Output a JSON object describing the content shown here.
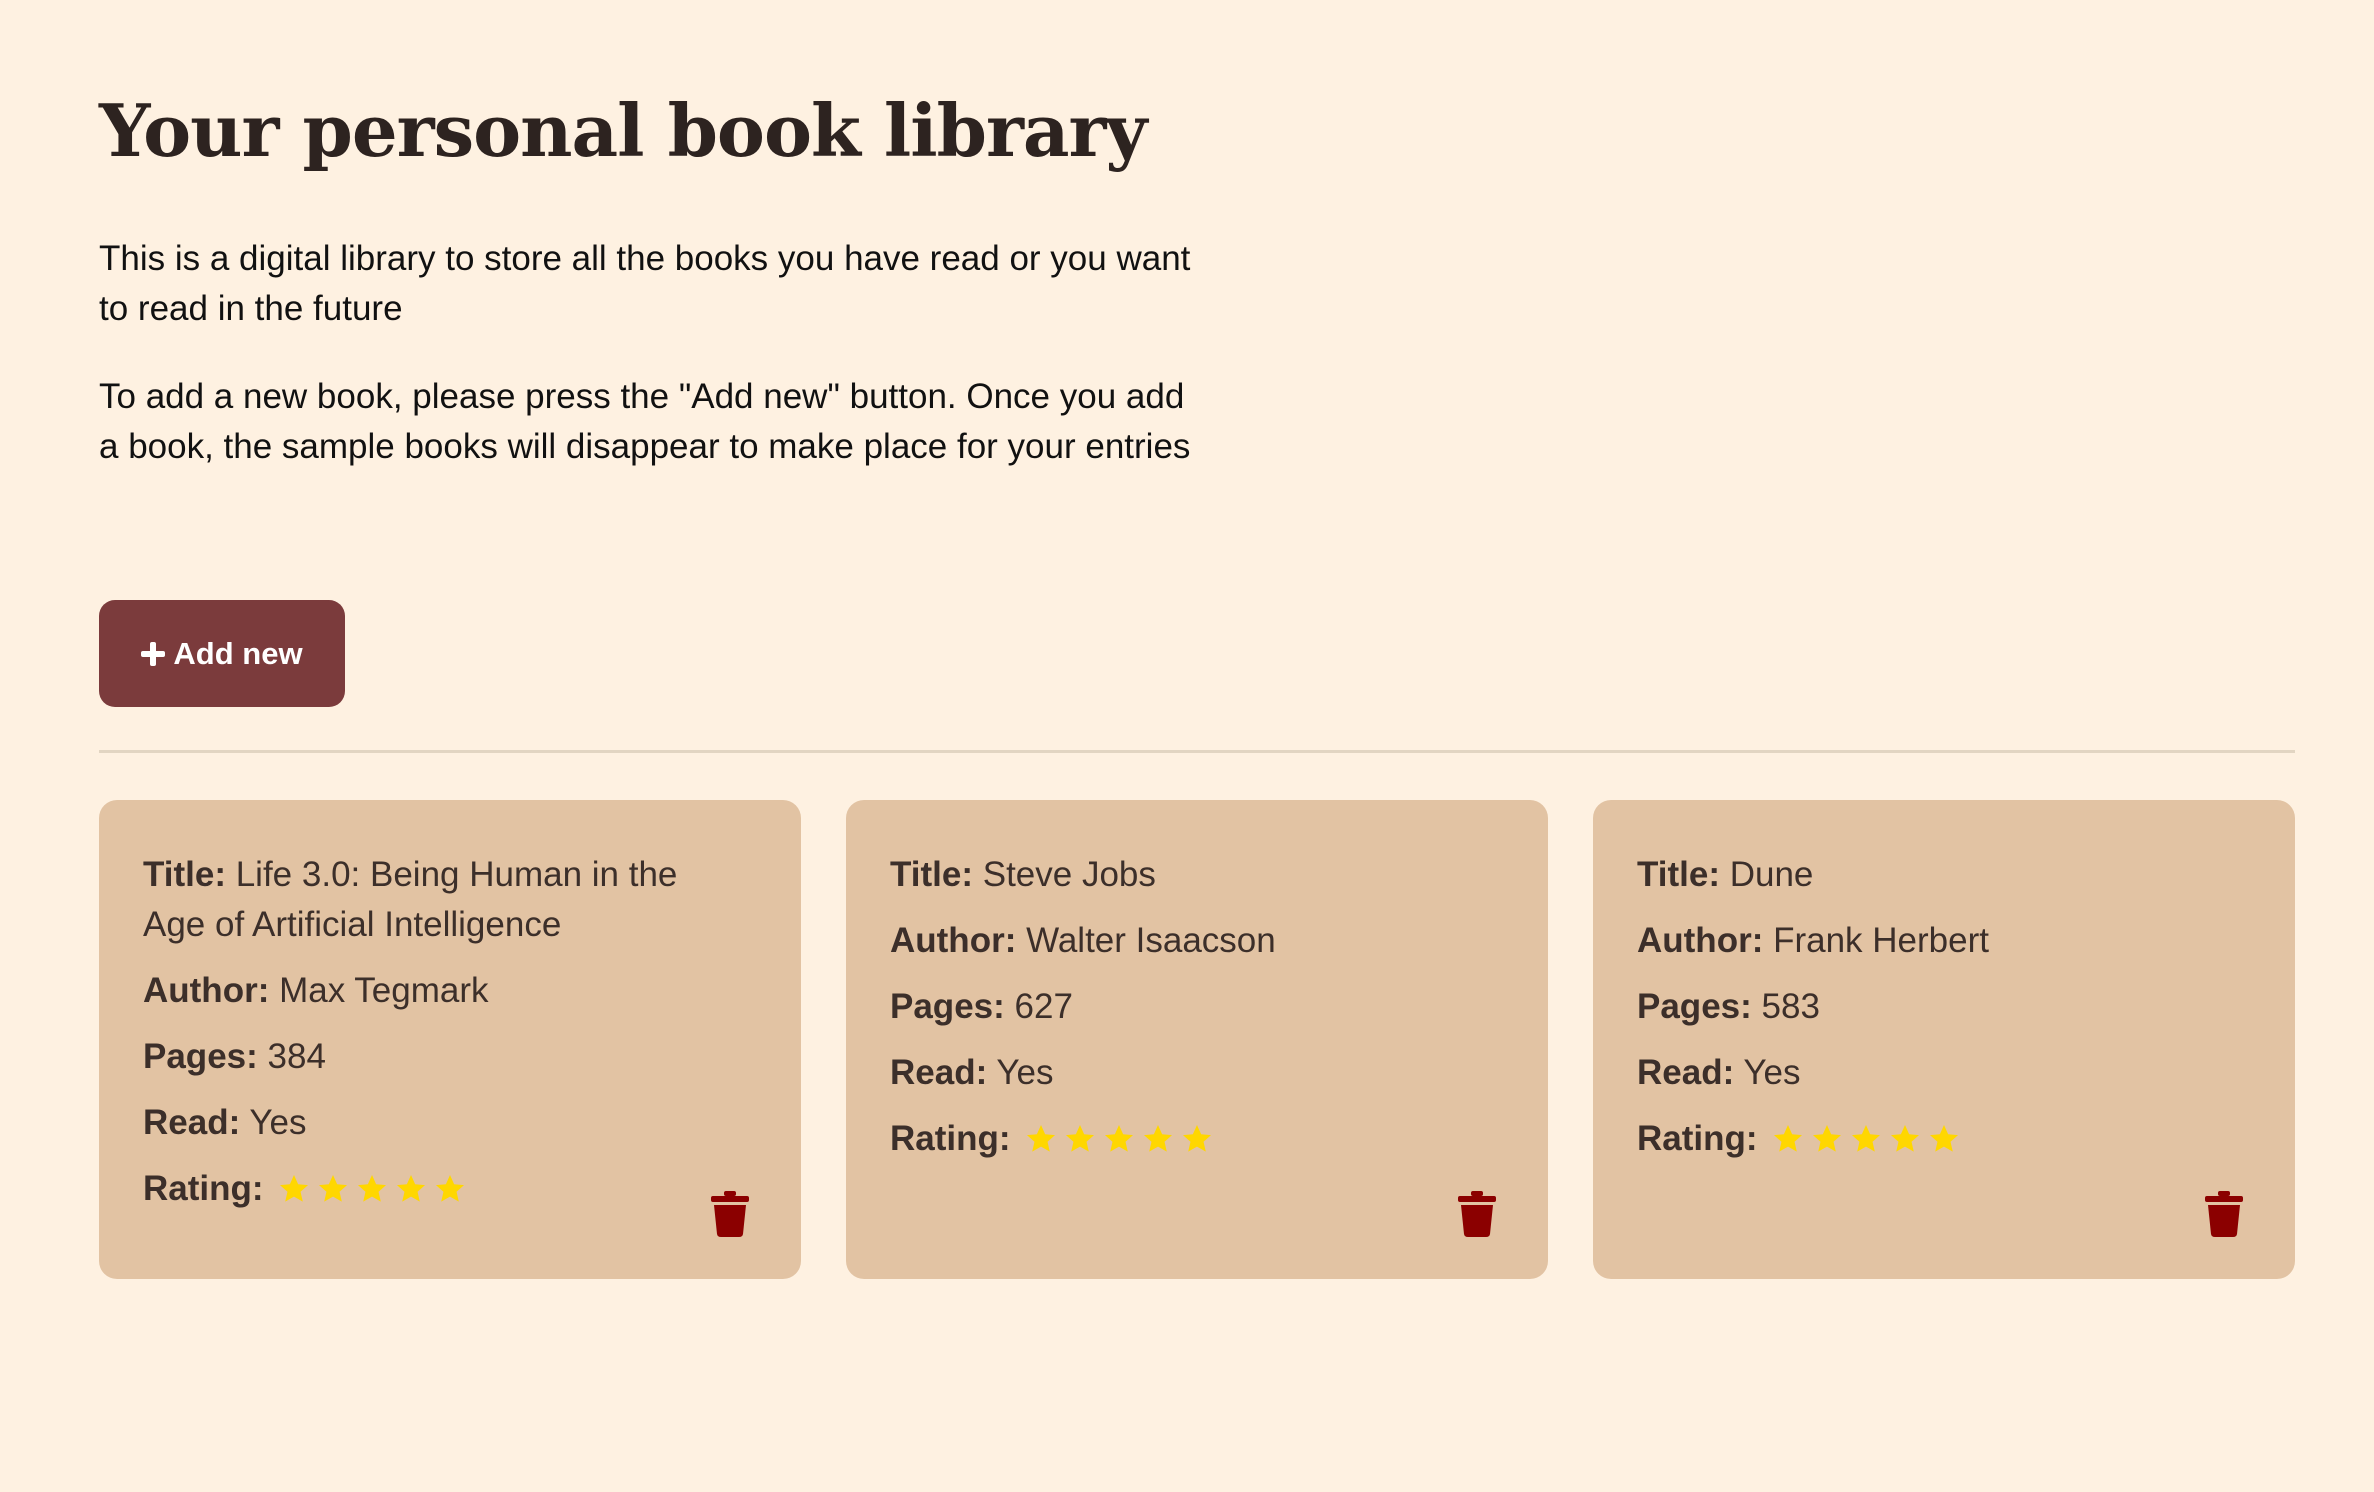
{
  "header": {
    "title": "Your personal book library",
    "intro_1": "This is a digital library to store all the books you have read or you want to read in the future",
    "intro_2": "To add a new book, please press the \"Add new\" button. Once you add a book, the sample books will disappear to make place for your entries"
  },
  "toolbar": {
    "add_label": "Add new",
    "add_icon": "plus-icon"
  },
  "labels": {
    "title": "Title:",
    "author": "Author:",
    "pages": "Pages:",
    "read": "Read:",
    "rating": "Rating:"
  },
  "colors": {
    "background": "#fef1e1",
    "card": "#e2c3a3",
    "button": "#7b3b3c",
    "star": "#ffd700",
    "trash": "#8b0000"
  },
  "books": [
    {
      "title": "Life 3.0: Being Human in the Age of Artificial Intelligence",
      "author": "Max Tegmark",
      "pages": "384",
      "read": "Yes",
      "rating": 5,
      "rating_max": 5
    },
    {
      "title": "Steve Jobs",
      "author": "Walter Isaacson",
      "pages": "627",
      "read": "Yes",
      "rating": 5,
      "rating_max": 5
    },
    {
      "title": "Dune",
      "author": "Frank Herbert",
      "pages": "583",
      "read": "Yes",
      "rating": 5,
      "rating_max": 5
    }
  ]
}
